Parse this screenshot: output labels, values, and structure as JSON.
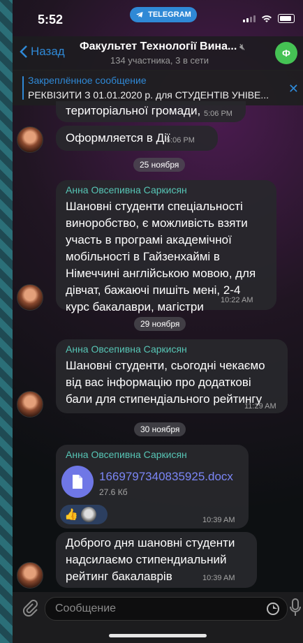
{
  "status": {
    "time": "5:52",
    "app_pill": "TELEGRAM"
  },
  "header": {
    "back_label": "Назад",
    "title": "Факультет Технології Вина...",
    "subtitle": "134 участника, 3 в сети",
    "avatar_letter": "Ф"
  },
  "pinned": {
    "title": "Закреплённое сообщение",
    "text": "РЕКВІЗИТИ З 01.01.2020 р. для СТУДЕНТІВ УНІВЕ..."
  },
  "messages": [
    {
      "text": "територіальної громади,",
      "time": "5:06 PM"
    },
    {
      "text": "Оформляется в Дії",
      "time": "5:06 PM"
    },
    {
      "date": "25 ноября"
    },
    {
      "author": "Анна Овсепивна Саркисян",
      "lines": [
        "Шановні студенти спеціальності",
        "виноробство, є можливість взяти",
        "участь в програмі академічної",
        "мобільності в Гайзенхаймі в",
        "Німеччині англійською мовою, для",
        "дівчат, бажаючі пишіть мені, 2-4",
        "курс бакалаври, магістри"
      ],
      "time": "10:22 AM"
    },
    {
      "date": "29 ноября"
    },
    {
      "author": "Анна Овсепивна Саркисян",
      "lines": [
        "Шановні студенти, сьогодні чекаємо",
        "від вас інформацію про додаткові",
        "бали для стипендіального  рейтингу"
      ],
      "time": "11:29 AM"
    },
    {
      "date": "30 ноября"
    },
    {
      "author": "Анна Овсепивна Саркисян",
      "file_name": "1669797340835925.docx",
      "file_size": "27.6 Кб",
      "reaction": "👍",
      "time": "10:39 AM"
    },
    {
      "lines": [
        "Доброго дня шановні студенти",
        "надсилаємо стипендиальний",
        "рейтинг бакалаврів"
      ],
      "time": "10:39 AM"
    }
  ],
  "input": {
    "placeholder": "Сообщение"
  },
  "colors": {
    "accent": "#2f89d6",
    "author": "#57c5b5",
    "file": "#6f77e6",
    "avatar": "#45c254"
  }
}
